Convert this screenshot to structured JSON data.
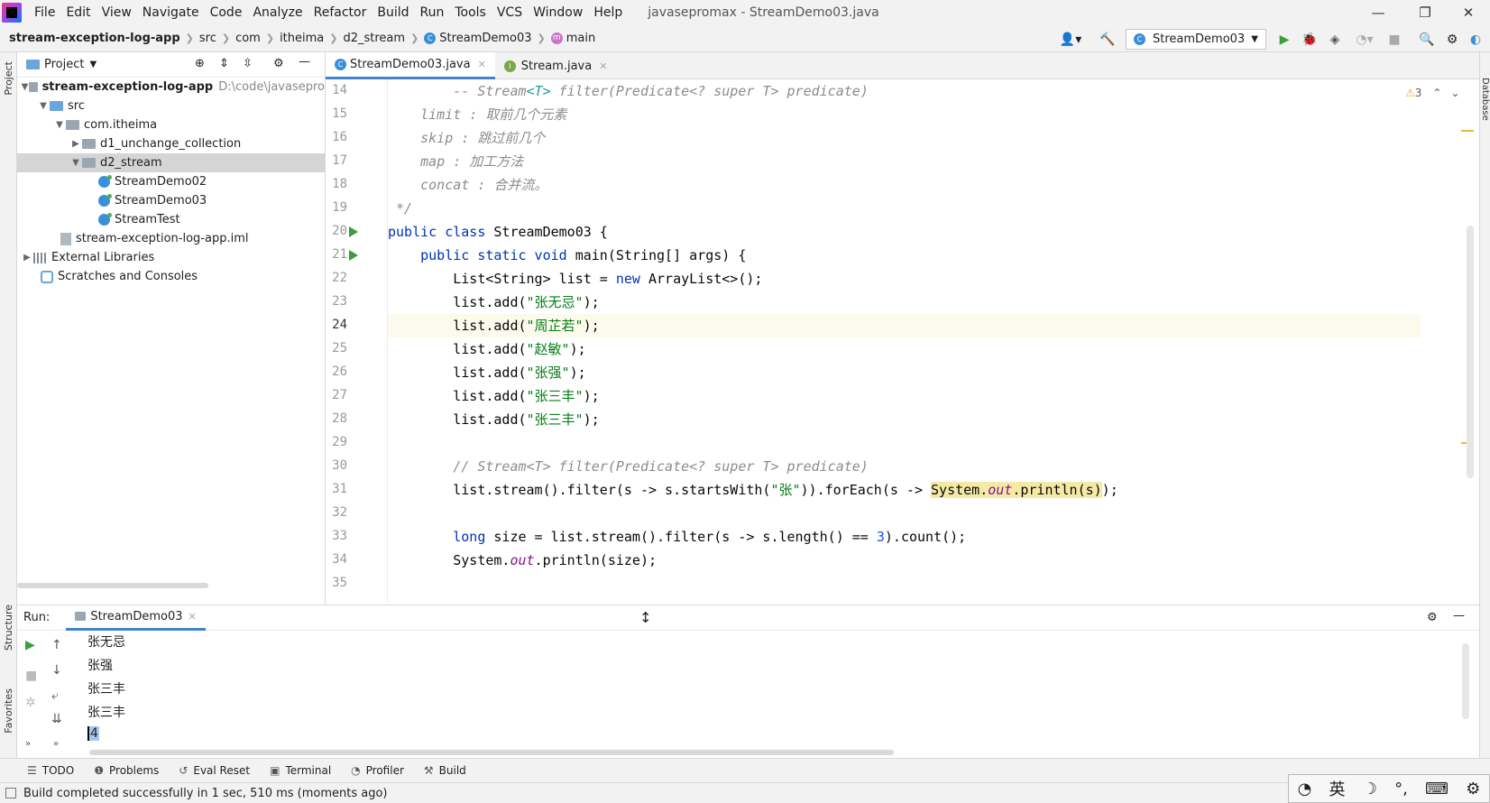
{
  "menubar": {
    "items": [
      "File",
      "Edit",
      "View",
      "Navigate",
      "Code",
      "Analyze",
      "Refactor",
      "Build",
      "Run",
      "Tools",
      "VCS",
      "Window",
      "Help"
    ],
    "window_title": "javasepromax - StreamDemo03.java"
  },
  "navbar": {
    "crumbs": [
      "stream-exception-log-app",
      "src",
      "com",
      "itheima",
      "d2_stream",
      "StreamDemo03",
      "main"
    ],
    "run_config": "StreamDemo03"
  },
  "project": {
    "title": "Project",
    "tree": [
      {
        "label": "stream-exception-log-app",
        "extra": "D:\\code\\javasepro"
      },
      {
        "label": "src"
      },
      {
        "label": "com.itheima"
      },
      {
        "label": "d1_unchange_collection"
      },
      {
        "label": "d2_stream"
      },
      {
        "label": "StreamDemo02"
      },
      {
        "label": "StreamDemo03"
      },
      {
        "label": "StreamTest"
      },
      {
        "label": "stream-exception-log-app.iml"
      },
      {
        "label": "External Libraries"
      },
      {
        "label": "Scratches and Consoles"
      }
    ]
  },
  "tabs": [
    {
      "label": "StreamDemo03.java"
    },
    {
      "label": "Stream.java"
    }
  ],
  "editor": {
    "warning_count": "3",
    "line_numbers": [
      "14",
      "15",
      "16",
      "17",
      "18",
      "19",
      "20",
      "21",
      "22",
      "23",
      "24",
      "25",
      "26",
      "27",
      "28",
      "29",
      "30",
      "31",
      "32",
      "33",
      "34",
      "35"
    ],
    "code": {
      "l14a": "        -- Stream",
      "l14b": "<T>",
      "l14c": " filter(Predicate<? super T> ",
      "l14d": "predicate",
      "l15": "    limit : 取前几个元素",
      "l16": "    skip : 跳过前几个",
      "l17": "    map : 加工方法",
      "l18": "    concat : 合并流。",
      "l19": " */",
      "l20a": "public class",
      "l20b": " StreamDemo03 {",
      "l21a": "    public static void",
      "l21b": " main(String[] args) {",
      "l22a": "        List<String> list = ",
      "l22b": "new",
      "l22c": " ArrayList<>();",
      "l23a": "        list.add(",
      "l23b": "\"张无忌\"",
      "l23c": ");",
      "l24a": "        list.add(",
      "l24b": "\"周芷若\"",
      "l24c": ");",
      "l25a": "        list.add(",
      "l25b": "\"赵敏\"",
      "l25c": ");",
      "l26a": "        list.add(",
      "l26b": "\"张强\"",
      "l26c": ");",
      "l27a": "        list.add(",
      "l27b": "\"张三丰\"",
      "l27c": ");",
      "l28a": "        list.add(",
      "l28b": "\"张三丰\"",
      "l28c": ");",
      "l30": "        // Stream<T> filter(Predicate<? super T> predicate)",
      "l31a": "        list.stream().filter(s -> s.startsWith(",
      "l31b": "\"张\"",
      "l31c": ")).forEach(s -> ",
      "l31d": "System.",
      "l31e": "out",
      "l31f": ".println(s)",
      ");": "",
      "l31g": ");",
      "l33a": "        long",
      "l33b": " size = list.stream().filter(s -> s.length() == ",
      "l33c": "3",
      "l33d": ").count();",
      "l34a": "        System.",
      "l34b": "out",
      "l34c": ".println(size);"
    }
  },
  "run": {
    "label": "Run:",
    "tab": "StreamDemo03",
    "output": [
      "张无忌",
      "张强",
      "张三丰",
      "张三丰",
      "4"
    ]
  },
  "leftstrip": {
    "project": "Project",
    "structure": "Structure",
    "favorites": "Favorites"
  },
  "rightstrip": {
    "database": "Database"
  },
  "toolwindows": [
    "TODO",
    "Problems",
    "Eval Reset",
    "Terminal",
    "Profiler",
    "Build"
  ],
  "status": {
    "text": "Build completed successfully in 1 sec, 510 ms (moments ago)"
  },
  "ime": {
    "lang": "英"
  },
  "colors": {
    "accent": "#4083c9",
    "run_green": "#3c9d3c",
    "keyword": "#0033b3",
    "string": "#067d17"
  }
}
